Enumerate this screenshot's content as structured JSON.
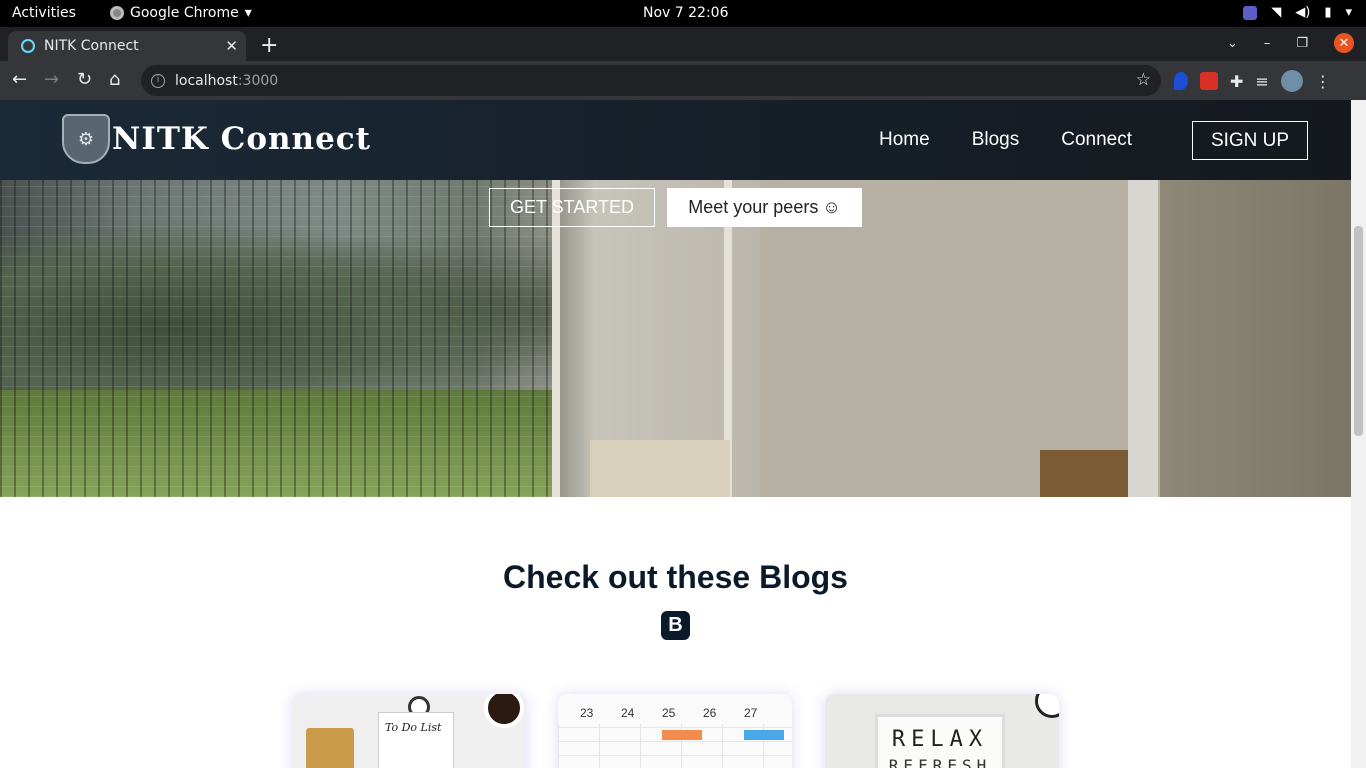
{
  "os_bar": {
    "activities": "Activities",
    "app_name": "Google Chrome",
    "clock": "Nov 7  22:06"
  },
  "browser": {
    "tab_title": "NITK Connect",
    "url_host": "localhost",
    "url_port": ":3000"
  },
  "site": {
    "logo_text": "NITK Connect",
    "nav": {
      "home": "Home",
      "blogs": "Blogs",
      "connect": "Connect",
      "signup": "SIGN UP"
    },
    "hero": {
      "get_started": "GET STARTED",
      "meet_peers": "Meet your peers",
      "meet_peers_emoji": "☺"
    },
    "blogs_section": {
      "title": "Check out these Blogs",
      "icon_letter": "B"
    },
    "cards": {
      "todo_text": "To Do List",
      "calendar_days": [
        "23",
        "24",
        "25",
        "26",
        "27"
      ],
      "relax_word": "RELAX",
      "refresh_word": "REFRESH"
    }
  },
  "colors": {
    "navbar": "#17212b",
    "heading": "#0b1a2b",
    "os_bar": "#000000",
    "chrome_dark": "#202124"
  }
}
